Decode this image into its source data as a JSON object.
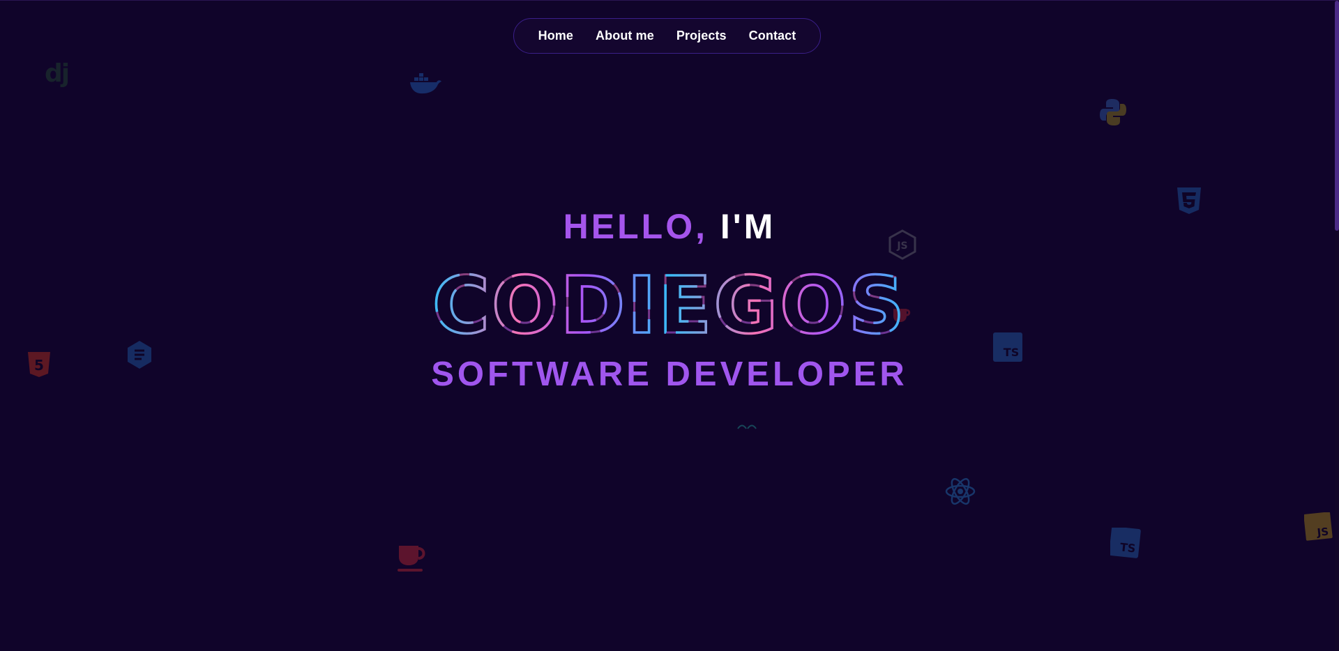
{
  "nav": {
    "items": [
      {
        "label": "Home"
      },
      {
        "label": "About me"
      },
      {
        "label": "Projects"
      },
      {
        "label": "Contact"
      }
    ]
  },
  "hero": {
    "greeting_part1": "HELLO,",
    "greeting_part2": "I'M",
    "name": "CODIEGOS",
    "role": "SOFTWARE DEVELOPER"
  },
  "background_icons": [
    {
      "name": "django-icon",
      "label": "dj"
    },
    {
      "name": "docker-icon"
    },
    {
      "name": "python-icon"
    },
    {
      "name": "css3-icon"
    },
    {
      "name": "nodejs-icon",
      "label": "JS"
    },
    {
      "name": "java-icon"
    },
    {
      "name": "typescript-icon",
      "label": "TS"
    },
    {
      "name": "html5-icon",
      "label": "5"
    },
    {
      "name": "sass-icon"
    },
    {
      "name": "react-icon"
    },
    {
      "name": "typescript-icon-2",
      "label": "TS"
    },
    {
      "name": "javascript-icon",
      "label": "JS"
    },
    {
      "name": "java-cup-icon"
    }
  ],
  "colors": {
    "background": "#10042a",
    "accent_purple": "#a555ec",
    "accent_pink": "#f472b6",
    "accent_cyan": "#38bdf8",
    "text": "#ffffff"
  }
}
